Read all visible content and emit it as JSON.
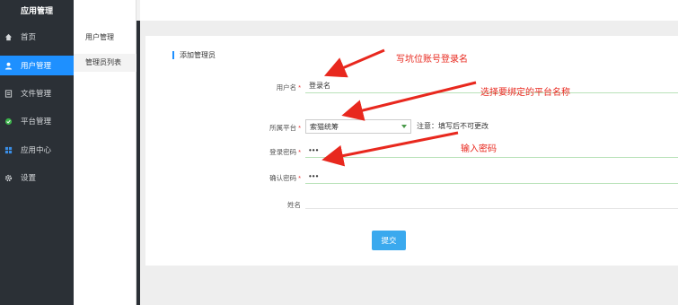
{
  "app": {
    "title": "应用管理"
  },
  "sidebar": {
    "items": [
      {
        "label": "首页",
        "icon": "home-icon"
      },
      {
        "label": "用户管理",
        "icon": "user-icon",
        "active": true
      },
      {
        "label": "文件管理",
        "icon": "file-icon"
      },
      {
        "label": "平台管理",
        "icon": "platform-icon"
      },
      {
        "label": "应用中心",
        "icon": "grid-icon"
      },
      {
        "label": "设置",
        "icon": "gear-icon"
      }
    ]
  },
  "subnav": {
    "title": "用户管理",
    "items": [
      {
        "label": "管理员列表"
      }
    ]
  },
  "form": {
    "title": "添加管理员",
    "username": {
      "label": "用户名",
      "value": "登录名"
    },
    "platform": {
      "label": "所属平台",
      "value": "索猫统筹",
      "hint": "注意：填写后不可更改"
    },
    "password": {
      "label": "登录密码",
      "value": "•••"
    },
    "confirm": {
      "label": "确认密码",
      "value": "•••"
    },
    "name": {
      "label": "姓名",
      "value": ""
    },
    "submit_label": "提交"
  },
  "annotations": {
    "a1": "写坑位账号登录名",
    "a2": "选择要绑定的平台名称",
    "a3": "输入密码"
  },
  "colors": {
    "accent": "#1e90ff",
    "sidebar": "#2b3036",
    "annotation": "#e8281e",
    "button": "#3aa9ee"
  }
}
